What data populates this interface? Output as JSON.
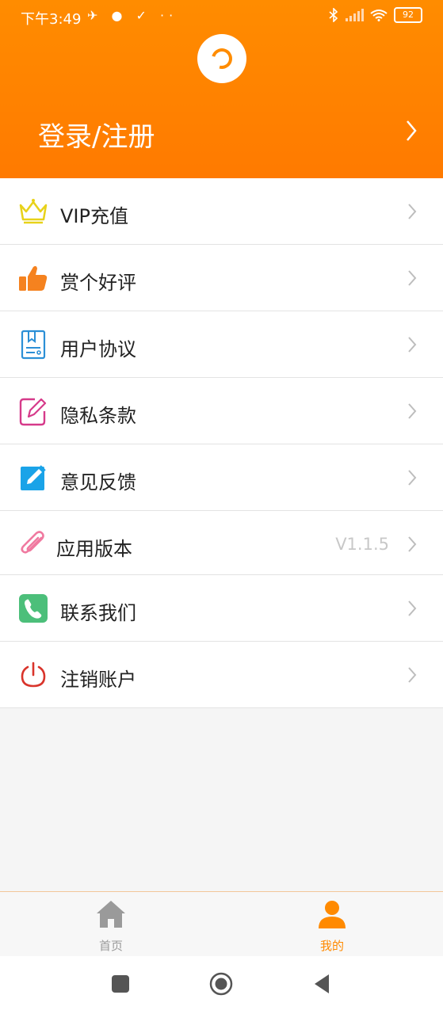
{
  "status_bar": {
    "time": "下午3:49",
    "left_icons": "✈ ● ✓ ··",
    "battery": "92"
  },
  "header": {
    "login_label": "登录/注册"
  },
  "menu": {
    "items": [
      {
        "label": "VIP充值",
        "icon": "crown-icon"
      },
      {
        "label": "赏个好评",
        "icon": "thumbs-up-icon"
      },
      {
        "label": "用户协议",
        "icon": "document-icon"
      },
      {
        "label": "隐私条款",
        "icon": "edit-note-icon"
      },
      {
        "label": "意见反馈",
        "icon": "pencil-icon"
      },
      {
        "label": "应用版本",
        "icon": "paperclip-icon",
        "value": "V1.1.5"
      },
      {
        "label": "联系我们",
        "icon": "phone-icon"
      },
      {
        "label": "注销账户",
        "icon": "power-icon"
      }
    ]
  },
  "tabbar": {
    "home_label": "首页",
    "mine_label": "我的"
  },
  "colors": {
    "accent": "#ff8000",
    "tab_active": "#ff8a00",
    "tab_inactive": "#9a9a9a"
  }
}
